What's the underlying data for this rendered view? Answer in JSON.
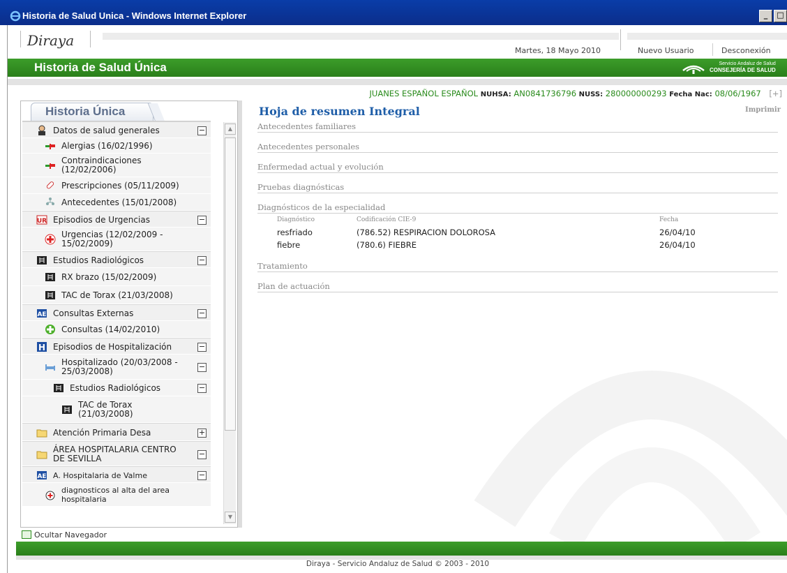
{
  "window": {
    "title": "Historia de Salud Unica - Windows Internet Explorer",
    "min": "_",
    "max": "□"
  },
  "header": {
    "logo": "Diraya",
    "date": "Martes, 18 Mayo 2010",
    "new_user": "Nuevo Usuario",
    "logout": "Desconexión",
    "app_title": "Historia de Salud Única",
    "org_line1": "Servicio Andaluz de Salud",
    "org_line2": "CONSEJERÍA DE SALUD"
  },
  "patient": {
    "name": "JUANES ESPAÑOL ESPAÑOL",
    "nuhsa_label": "NUHSA:",
    "nuhsa": "AN0841736796",
    "nuss_label": "NUSS:",
    "nuss": "280000000293",
    "dob_label": "Fecha Nac:",
    "dob": "08/06/1967",
    "expand": "[+]"
  },
  "nav": {
    "tab": "Historia Única",
    "items": [
      {
        "label": "Datos de salud generales",
        "toggle": "−"
      },
      {
        "label": "Alergias (16/02/1996)"
      },
      {
        "label": "Contraindicaciones\n(12/02/2006)"
      },
      {
        "label": "Prescripciones (05/11/2009)"
      },
      {
        "label": "Antecedentes (15/01/2008)"
      },
      {
        "label": "Episodios de Urgencias",
        "toggle": "−"
      },
      {
        "label": "Urgencias (12/02/2009 -\n15/02/2009)"
      },
      {
        "label": "Estudios Radiológicos",
        "toggle": "−"
      },
      {
        "label": "RX brazo (15/02/2009)"
      },
      {
        "label": "TAC de Torax (21/03/2008)"
      },
      {
        "label": "Consultas Externas",
        "toggle": "−"
      },
      {
        "label": "Consultas (14/02/2010)"
      },
      {
        "label": "Episodios de Hospitalización",
        "toggle": "−"
      },
      {
        "label": "Hospitalizado (20/03/2008 -\n25/03/2008)",
        "toggle": "−"
      },
      {
        "label": "Estudios Radiológicos",
        "toggle": "−"
      },
      {
        "label": "TAC de Torax\n(21/03/2008)"
      },
      {
        "label": "Atención Primaria Desa",
        "toggle": "+"
      },
      {
        "label": "ÁREA HOSPITALARIA CENTRO\nDE SEVILLA",
        "toggle": "−"
      },
      {
        "label": "A. Hospitalaria de Valme",
        "toggle": "−"
      },
      {
        "label": "diagnosticos al alta del area\nhospitalaria"
      }
    ]
  },
  "main": {
    "title": "Hoja de resumen Integral",
    "print": "Imprimir",
    "sections": [
      "Antecedentes familiares",
      "Antecedentes personales",
      "Enfermedad actual y evolución",
      "Pruebas diagnósticas",
      "Diagnósticos de la especialidad",
      "Tratamiento",
      "Plan de actuación"
    ],
    "diag_headers": [
      "Diagnóstico",
      "Codificación CIE-9",
      "Fecha"
    ],
    "diag_rows": [
      [
        "resfriado",
        "(786.52) RESPIRACION DOLOROSA",
        "26/04/10"
      ],
      [
        "fiebre",
        "(780.6) FIEBRE",
        "26/04/10"
      ]
    ]
  },
  "footer": {
    "hide_nav": "Ocultar Navegador",
    "copyright": "Diraya - Servicio Andaluz de Salud © 2003 - 2010"
  },
  "colors": {
    "green": "#2f8d1f",
    "title_blue": "#1f5ea8",
    "tab_text": "#5d6e8c"
  }
}
